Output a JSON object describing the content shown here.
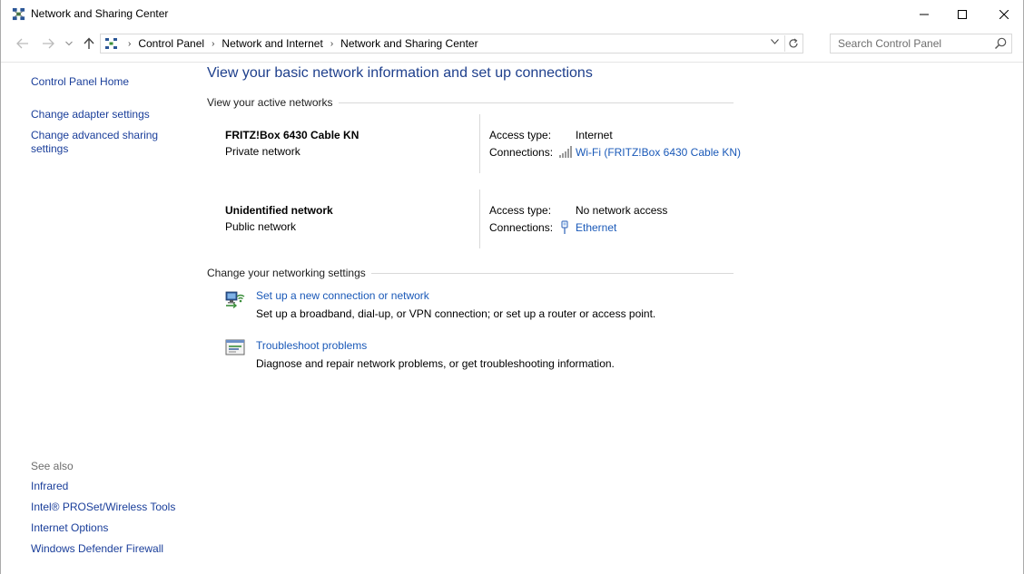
{
  "window": {
    "title": "Network and Sharing Center",
    "controls": {
      "minimize": "–",
      "maximize": "☐",
      "close": "✕"
    }
  },
  "address_bar": {
    "breadcrumbs": [
      "Control Panel",
      "Network and Internet",
      "Network and Sharing Center"
    ],
    "separator": "›",
    "icons": {
      "back": "arrow-left-icon",
      "forward": "arrow-right-icon",
      "up": "arrow-up-icon",
      "refresh": "refresh-icon",
      "dropdown": "chevron-down-icon"
    }
  },
  "search": {
    "placeholder": "Search Control Panel"
  },
  "sidebar": {
    "items": [
      {
        "label": "Control Panel Home"
      },
      {
        "label": "Change adapter settings"
      },
      {
        "label": "Change advanced sharing settings"
      }
    ],
    "see_also_label": "See also",
    "see_also": [
      {
        "label": "Infrared"
      },
      {
        "label": "Intel® PROSet/Wireless Tools"
      },
      {
        "label": "Internet Options"
      },
      {
        "label": "Windows Defender Firewall"
      }
    ]
  },
  "main": {
    "title": "View your basic network information and set up connections",
    "active_networks_heading": "View your active networks",
    "networks": [
      {
        "name": "FRITZ!Box 6430 Cable KN",
        "category": "Private network",
        "access_type_label": "Access type:",
        "access_type": "Internet",
        "connections_label": "Connections:",
        "connection": "Wi-Fi (FRITZ!Box 6430 Cable KN)",
        "connection_icon": "wifi-signal-icon"
      },
      {
        "name": "Unidentified network",
        "category": "Public network",
        "access_type_label": "Access type:",
        "access_type": "No network access",
        "connections_label": "Connections:",
        "connection": "Ethernet",
        "connection_icon": "ethernet-icon"
      }
    ],
    "settings_heading": "Change your networking settings",
    "tasks": [
      {
        "link": "Set up a new connection or network",
        "description": "Set up a broadband, dial-up, or VPN connection; or set up a router or access point.",
        "icon": "new-connection-icon"
      },
      {
        "link": "Troubleshoot problems",
        "description": "Diagnose and repair network problems, or get troubleshooting information.",
        "icon": "troubleshoot-icon"
      }
    ]
  },
  "colors": {
    "link": "#1a59b8",
    "title_blue": "#1e3f8c",
    "nav_link": "#1a3e9a",
    "muted": "#6d6d6d",
    "divider": "#d9d9d9"
  }
}
